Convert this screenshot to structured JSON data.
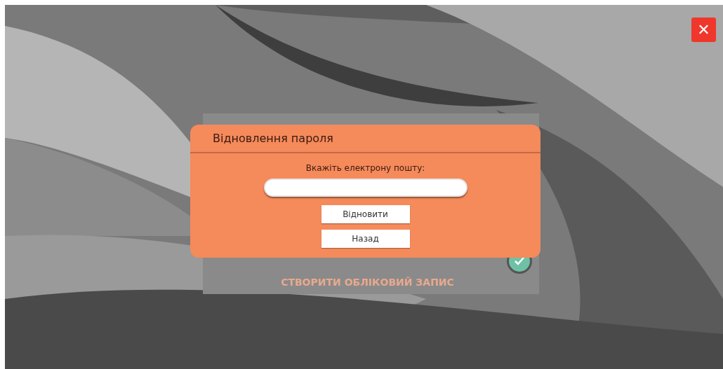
{
  "close_button": {
    "label": "✕"
  },
  "back_panel": {
    "link": "СТВОРИТИ ОБЛІКОВИЙ ЗАПИС",
    "confirm_checked": true
  },
  "dialog": {
    "title": "Відновлення пароля",
    "prompt": "Вкажіть електрону пошту:",
    "buttons": [
      "Відновити",
      "Назад"
    ]
  }
}
